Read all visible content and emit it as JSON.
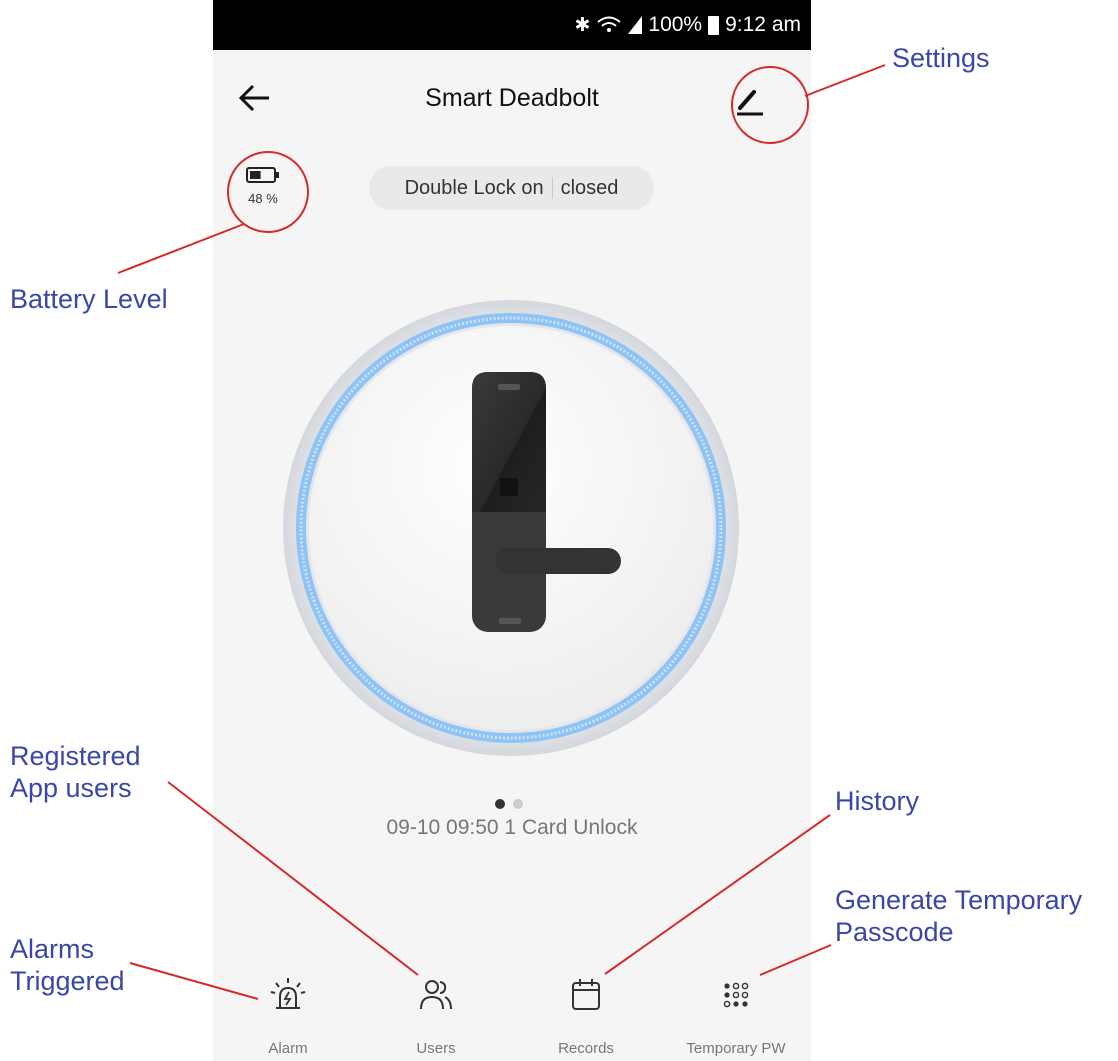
{
  "status_bar": {
    "battery_percent": "100%",
    "time": "9:12 am",
    "icons": [
      "bluetooth-icon",
      "wifi-icon",
      "signal-icon",
      "battery-icon"
    ]
  },
  "header": {
    "title": "Smart Deadbolt",
    "back_icon": "arrow-left-icon",
    "edit_icon": "pencil-icon"
  },
  "battery": {
    "percent_label": "48 %",
    "level": 0.48
  },
  "lock_status": {
    "mode": "Double Lock on",
    "state": "closed"
  },
  "carousel": {
    "pages": 2,
    "active_page": 1
  },
  "last_event": "09-10 09:50  1 Card Unlock",
  "tabs": [
    {
      "label": "Alarm",
      "icon": "alarm-siren-icon"
    },
    {
      "label": "Users",
      "icon": "users-icon"
    },
    {
      "label": "Records",
      "icon": "calendar-icon"
    },
    {
      "label": "Temporary PW",
      "icon": "keypad-icon"
    }
  ],
  "annotations": {
    "settings": "Settings",
    "battery_level": "Battery Level",
    "registered_users_line1": "Registered",
    "registered_users_line2": "App users",
    "history": "History",
    "alarms_line1": "Alarms",
    "alarms_line2": "Triggered",
    "temp_passcode_line1": "Generate Temporary",
    "temp_passcode_line2": "Passcode"
  },
  "colors": {
    "annotation_text": "#3a46a8",
    "annotation_line": "#d42a2a",
    "ring_blue": "#8fc3f5",
    "lock_body": "#2b2b2b"
  }
}
